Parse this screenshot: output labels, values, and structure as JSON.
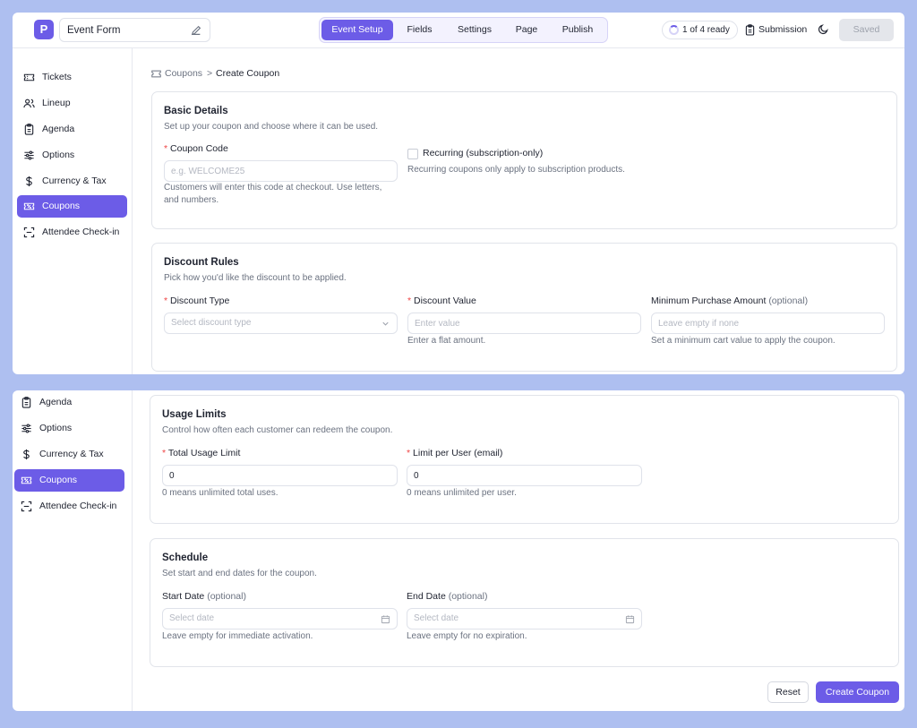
{
  "header": {
    "logo_letter": "P",
    "form_title": "Event Form",
    "tabs": [
      "Event Setup",
      "Fields",
      "Settings",
      "Page",
      "Publish"
    ],
    "active_tab": "Event Setup",
    "ready_status": "1 of 4 ready",
    "submission_label": "Submission",
    "saved_label": "Saved"
  },
  "sidebar_top": {
    "items": [
      {
        "label": "Tickets",
        "icon": "ticket-icon"
      },
      {
        "label": "Lineup",
        "icon": "users-icon"
      },
      {
        "label": "Agenda",
        "icon": "clipboard-icon"
      },
      {
        "label": "Options",
        "icon": "sliders-icon"
      },
      {
        "label": "Currency & Tax",
        "icon": "dollar-icon"
      },
      {
        "label": "Coupons",
        "icon": "coupon-icon"
      },
      {
        "label": "Attendee Check-in",
        "icon": "scan-icon"
      }
    ],
    "active": "Coupons"
  },
  "sidebar_bottom": {
    "items": [
      {
        "label": "Agenda",
        "icon": "clipboard-icon"
      },
      {
        "label": "Options",
        "icon": "sliders-icon"
      },
      {
        "label": "Currency & Tax",
        "icon": "dollar-icon"
      },
      {
        "label": "Coupons",
        "icon": "coupon-icon"
      },
      {
        "label": "Attendee Check-in",
        "icon": "scan-icon"
      }
    ],
    "active": "Coupons"
  },
  "breadcrumb": {
    "parent": "Coupons",
    "separator": ">",
    "current": "Create Coupon"
  },
  "basic_details": {
    "title": "Basic Details",
    "subtitle": "Set up your coupon and choose where it can be used.",
    "coupon_code_label": "Coupon Code",
    "coupon_code_placeholder": "e.g. WELCOME25",
    "coupon_code_hint": "Customers will enter this code at checkout. Use letters, and numbers.",
    "recurring_label": "Recurring (subscription-only)",
    "recurring_checked": false,
    "recurring_hint": "Recurring coupons only apply to subscription products."
  },
  "discount_rules": {
    "title": "Discount Rules",
    "subtitle": "Pick how you'd like the discount to be applied.",
    "type_label": "Discount Type",
    "type_placeholder": "Select discount type",
    "value_label": "Discount Value",
    "value_placeholder": "Enter value",
    "value_hint": "Enter a flat amount.",
    "min_label": "Minimum Purchase Amount",
    "min_optional": "(optional)",
    "min_placeholder": "Leave empty if none",
    "min_hint": "Set a minimum cart value to apply the coupon."
  },
  "usage_limits": {
    "title": "Usage Limits",
    "subtitle": "Control how often each customer can redeem the coupon.",
    "total_label": "Total Usage Limit",
    "total_value": "0",
    "total_hint": "0 means unlimited total uses.",
    "per_user_label": "Limit per User (email)",
    "per_user_value": "0",
    "per_user_hint": "0 means unlimited per user."
  },
  "schedule": {
    "title": "Schedule",
    "subtitle": "Set start and end dates for the coupon.",
    "start_label": "Start Date",
    "start_optional": "(optional)",
    "start_placeholder": "Select date",
    "start_hint": "Leave empty for immediate activation.",
    "end_label": "End Date",
    "end_optional": "(optional)",
    "end_placeholder": "Select date",
    "end_hint": "Leave empty for no expiration."
  },
  "actions": {
    "reset_label": "Reset",
    "create_label": "Create Coupon"
  },
  "colors": {
    "accent": "#6c5ce7",
    "background": "#aebff0",
    "required": "#ef4444"
  }
}
